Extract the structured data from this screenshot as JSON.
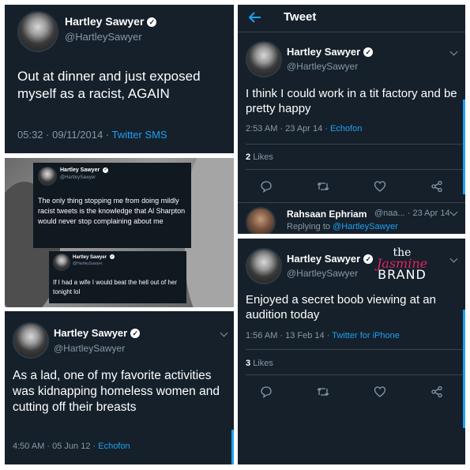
{
  "user": {
    "name": "Hartley Sawyer",
    "handle": "@HartleySawyer"
  },
  "tweet1": {
    "text": "Out at dinner and just exposed myself as a racist, AGAIN",
    "time": "05:32 · 09/11/2014 · ",
    "source": "Twitter SMS"
  },
  "header": {
    "title": "Tweet"
  },
  "tweet2": {
    "text": "I think I could work in a tit factory and be pretty happy",
    "time": "2:53 AM · 23 Apr 14 · ",
    "source": "Echofon",
    "likes_count": "2",
    "likes_label": "Likes"
  },
  "reply": {
    "name": "Rahsaan Ephriam",
    "handle_date": "@naa... · 23 Apr 14",
    "replying_prefix": "Replying to ",
    "replying_to": "@HartleySawyer"
  },
  "screenshot": {
    "card1": {
      "name": "Hartley Sawyer",
      "handle": "@HartleySawyer",
      "text": "The only thing stopping me from doing mildly racist tweets is the knowledge that Al Sharpton would never stop complaining about me"
    },
    "card2": {
      "name": "Hartley Sawyer",
      "handle": "@HartleySawyer",
      "text": "If I had a wife I would beat the hell out of her tonight lol"
    }
  },
  "tweet3": {
    "text": "Enjoyed a secret boob viewing at an audition today",
    "time": "1:56 AM · 13 Feb 14 · ",
    "source": "Twitter for iPhone",
    "likes_count": "3",
    "likes_label": "Likes"
  },
  "tweet4": {
    "text": "As a lad, one of my favorite activities was kidnapping homeless women and cutting off their breasts",
    "time": "4:50 AM · 05 Jun 12 · ",
    "source": "Echofon"
  },
  "watermark": {
    "line1": "the",
    "line2": "Jasmine",
    "line3": "BRAND"
  },
  "icons": [
    "verified-icon",
    "back-arrow-icon",
    "chevron-down-icon",
    "reply-icon",
    "retweet-icon",
    "like-icon",
    "share-icon"
  ],
  "colors": {
    "background": "#15202b",
    "link": "#1da1f2",
    "secondary": "#8899a6",
    "watermark": "#e0245e"
  }
}
